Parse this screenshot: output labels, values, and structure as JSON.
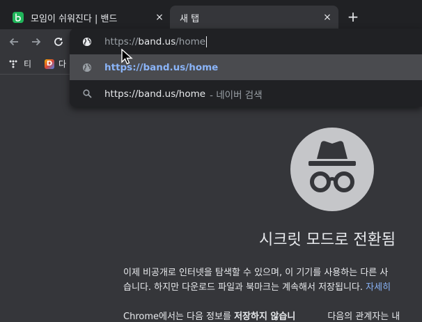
{
  "tabs": [
    {
      "title": "모임이 쉬워진다 | 밴드",
      "close": "×",
      "favicon": "band-icon",
      "active": false
    },
    {
      "title": "새 탭",
      "close": "×",
      "active": true
    }
  ],
  "new_tab_label": "+",
  "bookmarks": [
    {
      "label": "티",
      "icon": "tistory-icon"
    },
    {
      "label": "다",
      "icon": "daum-icon",
      "badge": "D"
    }
  ],
  "omnibox": {
    "input": {
      "scheme": "https://",
      "host": "band.us",
      "path": "/home"
    },
    "suggestions": [
      {
        "text": "https://band.us/home",
        "icon": "globe-icon"
      },
      {
        "text": "https://band.us/home",
        "suffix": "- 네이버 검색",
        "icon": "search-icon"
      }
    ]
  },
  "incognito": {
    "title": "시크릿 모드로 전환됨",
    "paragraph_line1": "이제 비공개로 인터넷을 탐색할 수 있으며, 이 기기를 사용하는 다른 사",
    "paragraph_line2": "습니다. 하지만 다운로드 파일과 북마크는 계속해서 저장됩니다. ",
    "learn_more": "자세히",
    "line3_a": "Chrome에서는 다음 정보를 ",
    "line3_bold": "저장하지 않습니",
    "line3_b": "다음의 관계자는 내"
  },
  "colors": {
    "frame": "#202124",
    "toolbar": "#35363a",
    "link": "#8ab4f8",
    "band_green": "#20b55a"
  }
}
